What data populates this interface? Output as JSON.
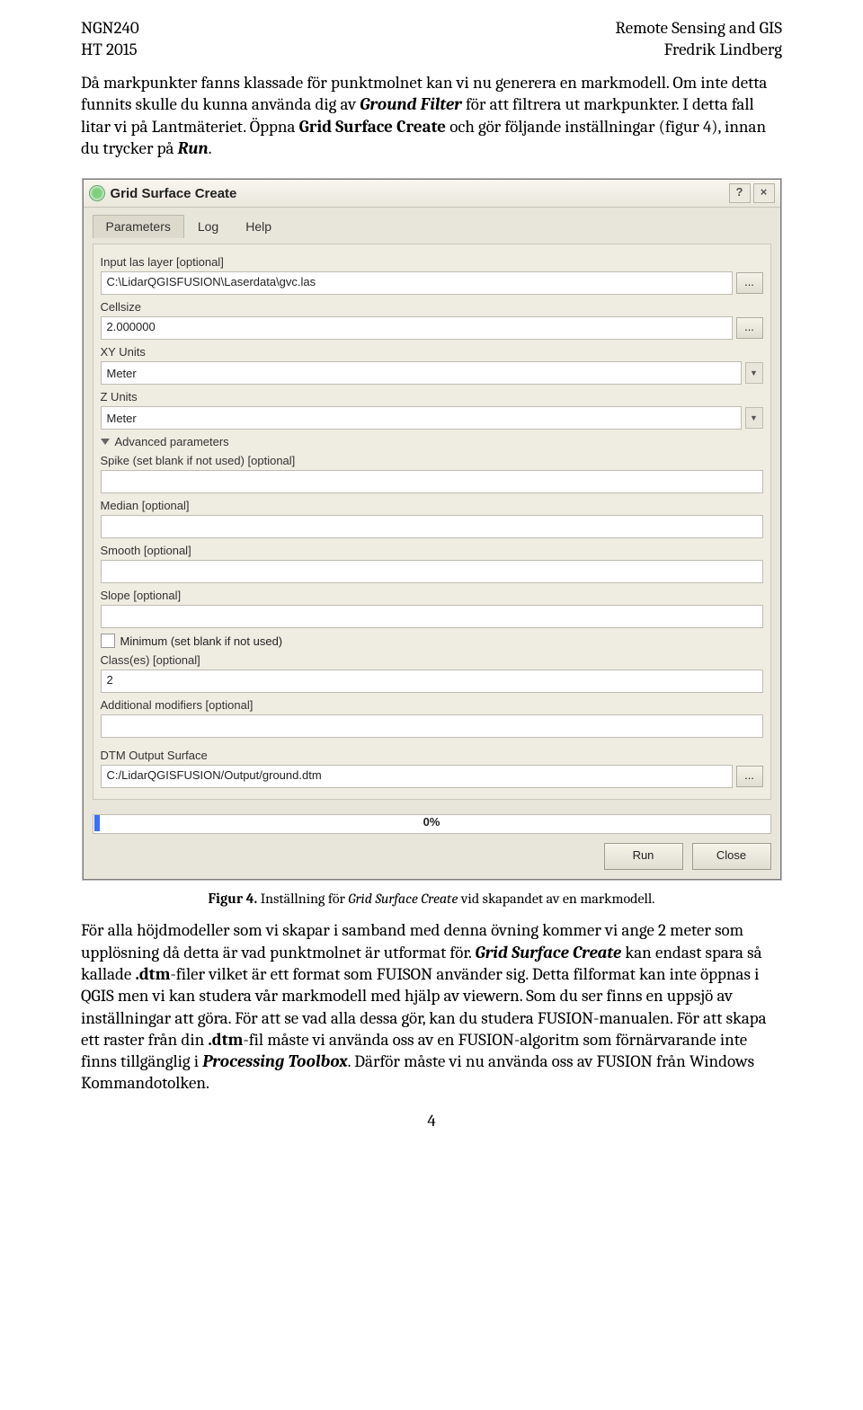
{
  "header": {
    "left1": "NGN240",
    "right1": "Remote Sensing and GIS",
    "left2": "HT 2015",
    "right2": "Fredrik Lindberg"
  },
  "para1": {
    "t1": "Då markpunkter fanns klassade för punktmolnet kan vi nu generera en markmodell. Om inte detta funnits skulle du kunna använda dig av ",
    "b1": "Ground Filter",
    "t2": " för att filtrera ut markpunkter. I detta fall litar vi på Lantmäteriet. Öppna ",
    "b2": "Grid Surface Create",
    "t3": " och gör följande inställningar (figur 4), innan du trycker på ",
    "b3": "Run",
    "t4": "."
  },
  "dialog": {
    "title": "Grid Surface Create",
    "help_btn": "?",
    "close_btn": "×",
    "tabs": {
      "parameters": "Parameters",
      "log": "Log",
      "help": "Help"
    },
    "labels": {
      "input_las": "Input las layer [optional]",
      "cellsize": "Cellsize",
      "xyunits": "XY Units",
      "zunits": "Z Units",
      "adv": "Advanced parameters",
      "spike": "Spike (set blank if not used) [optional]",
      "median": "Median [optional]",
      "smooth": "Smooth [optional]",
      "slope": "Slope [optional]",
      "minimum": "Minimum (set blank if not used)",
      "classes": "Class(es) [optional]",
      "additional": "Additional modifiers [optional]",
      "dtm_out": "DTM Output Surface"
    },
    "values": {
      "input_las": "C:\\LidarQGISFUSION\\Laserdata\\gvc.las",
      "cellsize": "2.000000",
      "xyunits": "Meter",
      "zunits": "Meter",
      "spike": "",
      "median": "",
      "smooth": "",
      "slope": "",
      "classes": "2",
      "additional": "",
      "dtm_out": "C:/LidarQGISFUSION/Output/ground.dtm"
    },
    "progress": "0%",
    "buttons": {
      "run": "Run",
      "close": "Close"
    }
  },
  "fig_caption": {
    "lead": "Figur 4.",
    "rest": " Inställning för ",
    "em": "Grid Surface Create",
    "tail": " vid skapandet av en markmodell."
  },
  "para2": {
    "t1": "För alla höjdmodeller som vi skapar i samband med denna övning kommer vi ange 2 meter som upplösning då detta är vad punktmolnet är utformat för. ",
    "b1": "Grid Surface Create",
    "t2": " kan endast spara så kallade ",
    "b2": ".dtm",
    "t3": "-filer vilket är ett format som FUISON använder sig. Detta filformat kan inte öppnas i QGIS men vi kan studera vår markmodell med hjälp av viewern. Som du ser finns en uppsjö av inställningar att göra. För att se vad alla dessa gör, kan du studera FUSION-manualen. För att skapa ett raster från din ",
    "b3": ".dtm",
    "t4": "-fil måste vi använda oss av en FUSION-algoritm som förnärvarande inte finns tillgänglig i ",
    "b4": "Processing Toolbox",
    "t5": ". Därför måste vi nu använda oss av FUSION från Windows Kommandotolken."
  },
  "page_number": "4"
}
